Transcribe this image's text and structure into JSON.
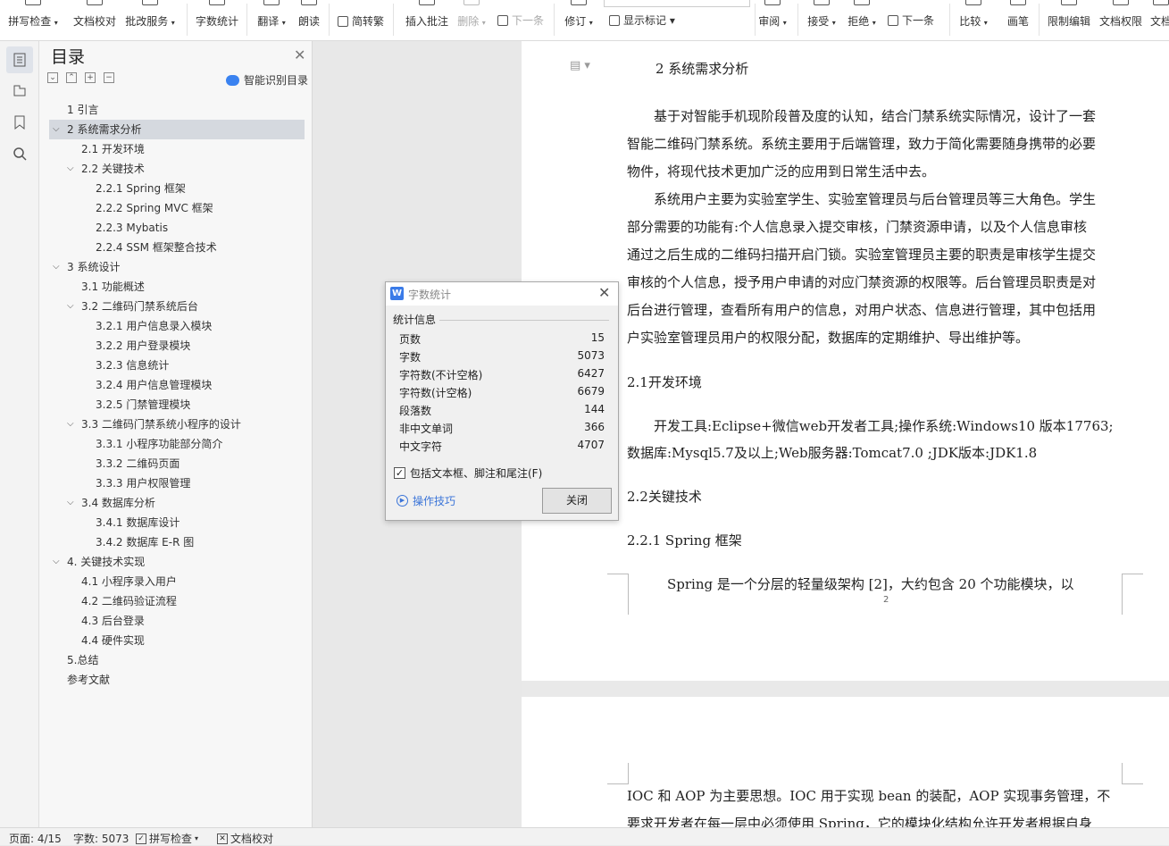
{
  "ribbon": {
    "items": [
      {
        "label": "拼写检查",
        "arrow": true
      },
      {
        "label": "文档校对",
        "arrow": false
      },
      {
        "label": "批改服务",
        "arrow": true
      },
      {
        "label": "字数统计",
        "arrow": false
      },
      {
        "label": "翻译",
        "arrow": true
      },
      {
        "label": "朗读",
        "arrow": false
      },
      {
        "label": "插入批注",
        "arrow": false
      },
      {
        "label": "删除",
        "arrow": true
      },
      {
        "label": "修订",
        "arrow": true
      },
      {
        "label": "审阅",
        "arrow": true
      },
      {
        "label": "接受",
        "arrow": true
      },
      {
        "label": "拒绝",
        "arrow": true
      },
      {
        "label": "比较",
        "arrow": true
      },
      {
        "label": "画笔",
        "arrow": false
      },
      {
        "label": "限制编辑",
        "arrow": false
      },
      {
        "label": "文档权限",
        "arrow": false
      },
      {
        "label": "文档",
        "arrow": false
      }
    ],
    "simp_trad": "简转繁",
    "prev_label": "下一条",
    "next_label": "下一条",
    "show_marks": "显示标记"
  },
  "toc": {
    "title": "目录",
    "smart_label": "智能识别目录",
    "items": [
      {
        "text": "1  引言",
        "level": 1,
        "caret": ""
      },
      {
        "text": "2  系统需求分析",
        "level": 1,
        "caret": "v",
        "selected": true
      },
      {
        "text": "2.1 开发环境",
        "level": 2,
        "caret": ""
      },
      {
        "text": "2.2 关键技术",
        "level": 2,
        "caret": "v"
      },
      {
        "text": "2.2.1 Spring  框架",
        "level": 3,
        "caret": ""
      },
      {
        "text": "2.2.2 Spring MVC  框架",
        "level": 3,
        "caret": ""
      },
      {
        "text": "2.2.3 Mybatis",
        "level": 3,
        "caret": ""
      },
      {
        "text": "2.2.4 SSM  框架整合技术",
        "level": 3,
        "caret": ""
      },
      {
        "text": "3  系统设计",
        "level": 1,
        "caret": "v"
      },
      {
        "text": "3.1  功能概述",
        "level": 2,
        "caret": ""
      },
      {
        "text": "3.2  二维码门禁系统后台",
        "level": 2,
        "caret": "v"
      },
      {
        "text": "3.2.1  用户信息录入模块",
        "level": 3,
        "caret": ""
      },
      {
        "text": "3.2.2  用户登录模块",
        "level": 3,
        "caret": ""
      },
      {
        "text": "3.2.3  信息统计",
        "level": 3,
        "caret": ""
      },
      {
        "text": "3.2.4  用户信息管理模块",
        "level": 3,
        "caret": ""
      },
      {
        "text": "3.2.5  门禁管理模块",
        "level": 3,
        "caret": ""
      },
      {
        "text": "3.3  二维码门禁系统小程序的设计",
        "level": 2,
        "caret": "v"
      },
      {
        "text": "3.3.1  小程序功能部分简介",
        "level": 3,
        "caret": ""
      },
      {
        "text": "3.3.2  二维码页面",
        "level": 3,
        "caret": ""
      },
      {
        "text": "3.3.3  用户权限管理",
        "level": 3,
        "caret": ""
      },
      {
        "text": "3.4    数据库分析",
        "level": 2,
        "caret": "v"
      },
      {
        "text": "3.4.1  数据库设计",
        "level": 3,
        "caret": ""
      },
      {
        "text": "3.4.2  数据库 E-R 图",
        "level": 3,
        "caret": ""
      },
      {
        "text": "4.  关键技术实现",
        "level": 1,
        "caret": "v"
      },
      {
        "text": "4.1  小程序录入用户",
        "level": 2,
        "caret": ""
      },
      {
        "text": "4.2  二维码验证流程",
        "level": 2,
        "caret": ""
      },
      {
        "text": "4.3  后台登录",
        "level": 2,
        "caret": ""
      },
      {
        "text": "4.4  硬件实现",
        "level": 2,
        "caret": ""
      },
      {
        "text": "5.总结",
        "level": 1,
        "caret": ""
      },
      {
        "text": "参考文献",
        "level": 1,
        "caret": ""
      }
    ]
  },
  "document": {
    "lines": [
      "2  系统需求分析",
      "　　基于对智能手机现阶段普及度的认知，结合门禁系统实际情况，设计了一套",
      "智能二维码门禁系统。系统主要用于后端管理，致力于简化需要随身携带的必要",
      "物件，将现代技术更加广泛的应用到日常生活中去。",
      "　　系统用户主要为实验室学生、实验室管理员与后台管理员等三大角色。学生",
      "部分需要的功能有:个人信息录入提交审核，门禁资源申请，以及个人信息审核",
      "通过之后生成的二维码扫描开启门锁。实验室管理员主要的职责是审核学生提交",
      "审核的个人信息，授予用户申请的对应门禁资源的权限等。后台管理员职责是对",
      "后台进行管理，查看所有用户的信息，对用户状态、信息进行管理，其中包括用",
      "户实验室管理员用户的权限分配，数据库的定期维护、导出维护等。",
      "2.1开发环境",
      "　　开发工具:Eclipse+微信web开发者工具;操作系统:Windows10 版本17763;",
      "数据库:Mysql5.7及以上;Web服务器:Tomcat7.0 ;JDK版本:JDK1.8",
      "2.2关键技术",
      "2.2.1 Spring 框架",
      "　　　Spring 是一个分层的轻量级架构 [2]，大约包含 20 个功能模块，以"
    ],
    "page_number": "2",
    "page2_lines": [
      "IOC 和 AOP 为主要思想。IOC 用于实现 bean 的装配，AOP 实现事务管理，不",
      "要求开发者在每一层中必须使用 Spring，它的模块化结构允许开发者根据自身"
    ]
  },
  "dialog": {
    "title": "字数统计",
    "group_label": "统计信息",
    "stats": [
      {
        "key": "页数",
        "value": "15"
      },
      {
        "key": "字数",
        "value": "5073"
      },
      {
        "key": "字符数(不计空格)",
        "value": "6427"
      },
      {
        "key": "字符数(计空格)",
        "value": "6679"
      },
      {
        "key": "段落数",
        "value": "144"
      },
      {
        "key": "非中文单词",
        "value": "366"
      },
      {
        "key": "中文字符",
        "value": "4707"
      }
    ],
    "checkbox_label": "包括文本框、脚注和尾注(F)",
    "tips_label": "操作技巧",
    "close_label": "关闭"
  },
  "status": {
    "page": "页面: 4/15",
    "words": "字数: 5073",
    "spell": "拼写检查",
    "proof": "文档校对"
  },
  "colors": {
    "accent": "#3a7be8",
    "selected_bg": "#d5d9df",
    "link": "#3a74d8"
  }
}
